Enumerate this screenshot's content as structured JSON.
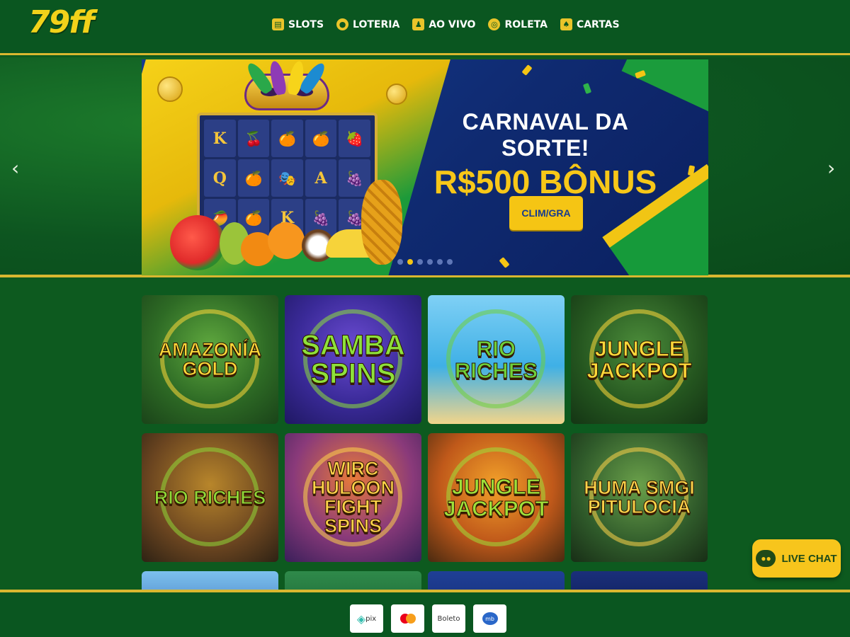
{
  "logo": "79ff",
  "nav": [
    {
      "label": "SLOTS",
      "icon": "slot-machine-icon"
    },
    {
      "label": "LOTERIA",
      "icon": "lottery-ball-icon"
    },
    {
      "label": "AO VIVO",
      "icon": "live-dealer-icon"
    },
    {
      "label": "ROLETA",
      "icon": "roulette-icon"
    },
    {
      "label": "CARTAS",
      "icon": "cards-icon"
    }
  ],
  "banner": {
    "title": "CARNAVAL DA SORTE!",
    "bonus": "R$500 BÔNUS",
    "cta": "CLIM/GRA",
    "slides": 6,
    "active_slide": 1,
    "reel_symbols": [
      "K",
      "🍒",
      "🍊",
      "🍊",
      "🍓",
      "Q",
      "🍊",
      "🎭",
      "A",
      "🍇",
      "🥭",
      "🍊",
      "K",
      "🍇",
      "🍇"
    ]
  },
  "carousel": {
    "prev": "‹",
    "next": "›"
  },
  "games": [
    {
      "title_lines": [
        "AMAZONÍA",
        "GOLD"
      ],
      "theme": "jungle"
    },
    {
      "title_lines": [
        "SAMBA",
        "SPINS"
      ],
      "theme": "purple"
    },
    {
      "title_lines": [
        "RIO",
        "RICHES"
      ],
      "theme": "beach"
    },
    {
      "title_lines": [
        "JUNGLE",
        "JACKPOT"
      ],
      "theme": "jungle-dark"
    },
    {
      "title_lines": [
        "RIO RICHES"
      ],
      "theme": "temple"
    },
    {
      "title_lines": [
        "WIRC",
        "HULOON FIGHT",
        "SPINS"
      ],
      "theme": "sunset"
    },
    {
      "title_lines": [
        "JUNGLE",
        "JACKPOT"
      ],
      "theme": "orange"
    },
    {
      "title_lines": [
        "HUMA SMGI",
        "PITULOCIA"
      ],
      "theme": "ruins"
    }
  ],
  "payments": [
    "pix",
    "mastercard",
    "Boleto",
    "mb"
  ],
  "live_chat": "LIVE CHAT",
  "colors": {
    "page_bg": "#0d5a1f",
    "gold": "#d9b730",
    "accent_yellow": "#f5c514",
    "banner_blue": "#163b8f"
  }
}
